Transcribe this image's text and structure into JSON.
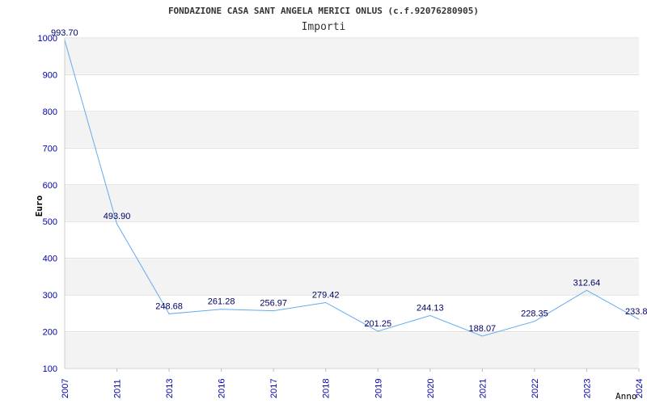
{
  "chart_data": {
    "type": "line",
    "title": "FONDAZIONE CASA SANT ANGELA MERICI ONLUS (c.f.92076280905)",
    "subtitle": "Importi",
    "xlabel": "Anno",
    "ylabel": "Euro",
    "ylim": [
      100,
      1000
    ],
    "yticks": [
      100,
      200,
      300,
      400,
      500,
      600,
      700,
      800,
      900,
      1000
    ],
    "grid": true,
    "categories": [
      "2007",
      "2011",
      "2013",
      "2016",
      "2017",
      "2018",
      "2019",
      "2020",
      "2021",
      "2022",
      "2023",
      "2024"
    ],
    "values": [
      993.7,
      493.9,
      248.68,
      261.28,
      256.97,
      279.42,
      201.25,
      244.13,
      188.07,
      228.35,
      312.64,
      233.8
    ],
    "data_labels": [
      "993.70",
      "493.90",
      "248.68",
      "261.28",
      "256.97",
      "279.42",
      "201.25",
      "244.13",
      "188.07",
      "228.35",
      "312.64",
      "233.8"
    ],
    "colors": {
      "line": "#66aaee",
      "axis_text": "#0000aa",
      "label_text": "#000066",
      "band": "#f3f3f3",
      "grid": "#dddddd"
    }
  }
}
